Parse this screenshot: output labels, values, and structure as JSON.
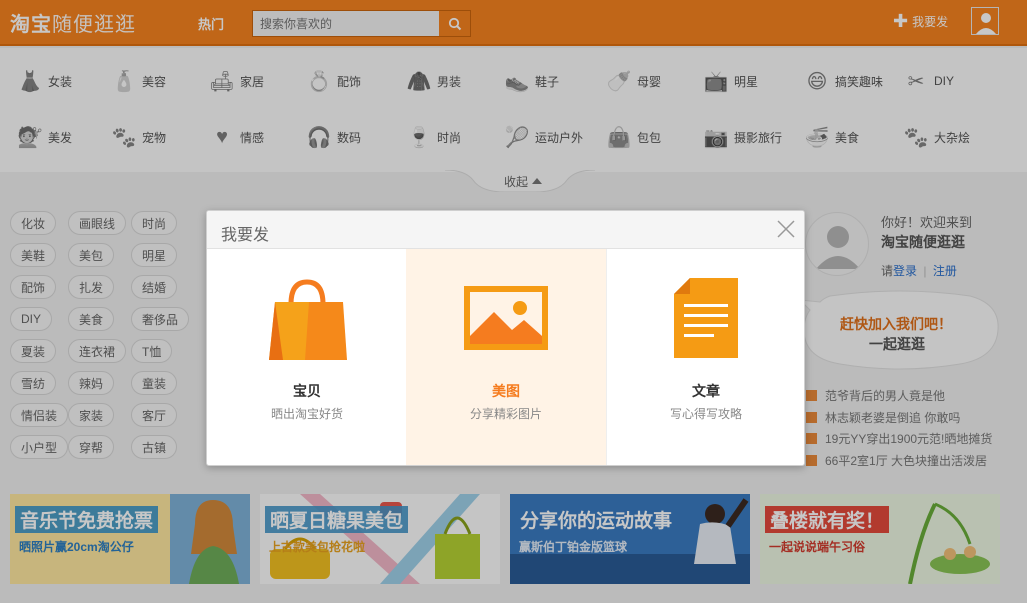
{
  "header": {
    "logo_strong": "淘宝",
    "logo_light": "随便逛逛",
    "hot": "热门",
    "search_placeholder": "搜索你喜欢的",
    "post_label": "我要发"
  },
  "categories": [
    {
      "label": "女装",
      "icon": "dress-icon"
    },
    {
      "label": "美容",
      "icon": "cosmetics-icon"
    },
    {
      "label": "家居",
      "icon": "sofa-icon"
    },
    {
      "label": "配饰",
      "icon": "ring-icon"
    },
    {
      "label": "男装",
      "icon": "suit-icon"
    },
    {
      "label": "鞋子",
      "icon": "shoe-icon"
    },
    {
      "label": "母婴",
      "icon": "baby-bottle-icon"
    },
    {
      "label": "明星",
      "icon": "star-tv-icon"
    },
    {
      "label": "搞笑趣味",
      "icon": "funny-face-icon"
    },
    {
      "label": "DIY",
      "icon": "scissors-icon"
    },
    {
      "label": "美发",
      "icon": "hair-icon"
    },
    {
      "label": "宠物",
      "icon": "paw-icon"
    },
    {
      "label": "情感",
      "icon": "heart-icon"
    },
    {
      "label": "数码",
      "icon": "headphones-icon"
    },
    {
      "label": "时尚",
      "icon": "wine-icon"
    },
    {
      "label": "运动户外",
      "icon": "racket-icon"
    },
    {
      "label": "包包",
      "icon": "bag-icon"
    },
    {
      "label": "摄影旅行",
      "icon": "camera-icon"
    },
    {
      "label": "美食",
      "icon": "noodle-icon"
    },
    {
      "label": "大杂烩",
      "icon": "mixed-icon"
    }
  ],
  "collapse_label": "收起",
  "tags": [
    "化妆",
    "画眼线",
    "时尚",
    "美鞋",
    "美包",
    "明星",
    "配饰",
    "扎发",
    "结婚",
    "DIY",
    "美食",
    "奢侈品",
    "夏装",
    "连衣裙",
    "T恤",
    "雪纺",
    "辣妈",
    "童装",
    "情侣装",
    "家装",
    "客厅",
    "小户型",
    "穿帮",
    "古镇"
  ],
  "user": {
    "greeting": "你好！欢迎来到",
    "brand": "淘宝随便逛逛",
    "login_prefix": "请",
    "login": "登录",
    "sep": "|",
    "register": "注册"
  },
  "bubble": {
    "line1": "赶快加入我们吧！",
    "line2": "一起逛逛"
  },
  "news": [
    "范爷背后的男人竟是他",
    "林志颖老婆是倒追 你敢吗",
    "19元YY穿出1900元范!晒地摊货",
    "66平2室1厅 大色块撞出活泼居"
  ],
  "banners": [
    {
      "title": "音乐节免费抢票",
      "sub": "晒照片赢20cm淘公仔"
    },
    {
      "title": "晒夏日糖果美包",
      "sub": "上古款美包抢花啦"
    },
    {
      "title": "分享你的运动故事",
      "sub": "赢斯伯丁铂金版篮球"
    },
    {
      "title": "叠楼就有奖！",
      "sub": "一起说说端午习俗"
    }
  ],
  "modal": {
    "title": "我要发",
    "options": [
      {
        "title": "宝贝",
        "sub": "晒出淘宝好货"
      },
      {
        "title": "美图",
        "sub": "分享精彩图片"
      },
      {
        "title": "文章",
        "sub": "写心得写攻略"
      }
    ]
  },
  "colors": {
    "brand_orange": "#f7831f",
    "selected_bg": "#fff3e6"
  }
}
